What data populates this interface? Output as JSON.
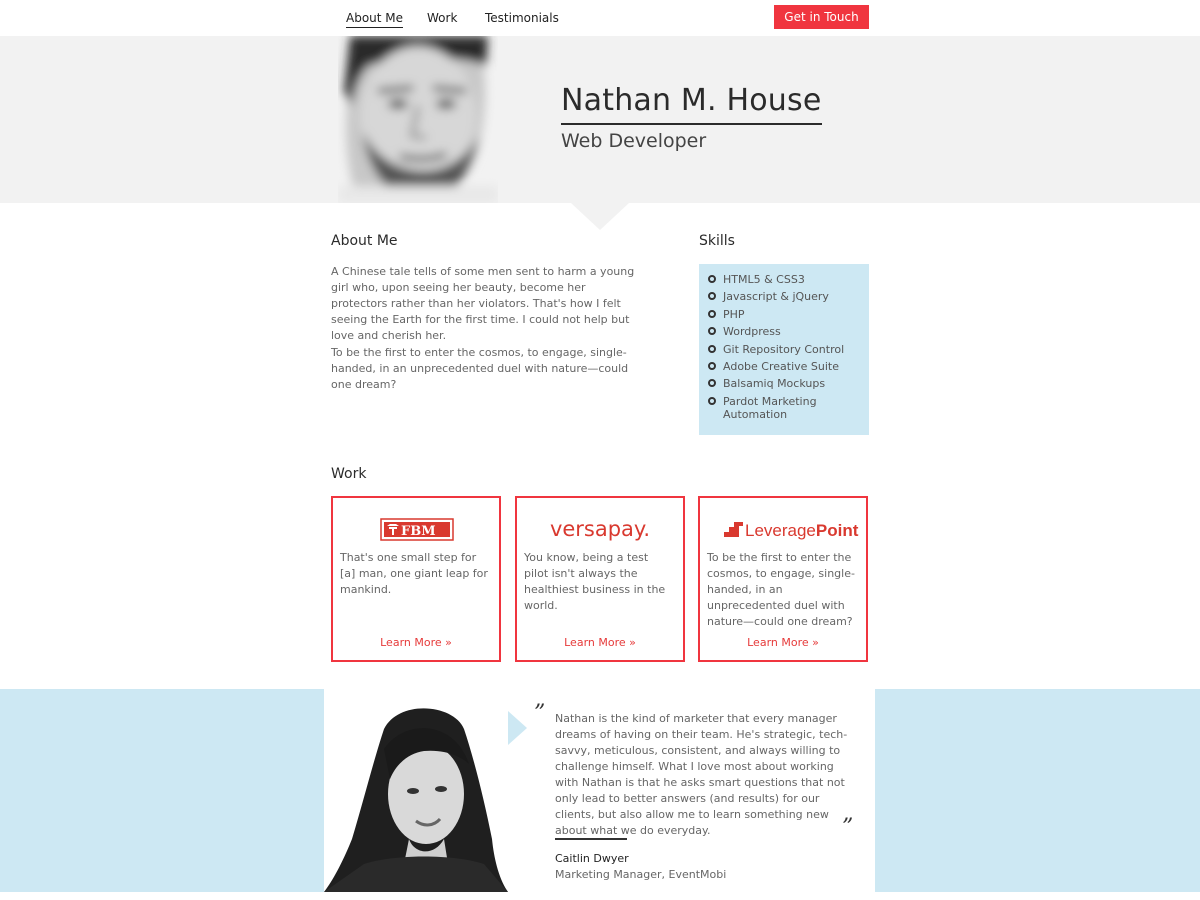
{
  "nav": {
    "items": [
      "About Me",
      "Work",
      "Testimonials"
    ],
    "active": "About Me",
    "cta_label": "Get in Touch"
  },
  "hero": {
    "name": "Nathan M. House",
    "role": "Web Developer"
  },
  "about": {
    "heading": "About Me",
    "para1": "A Chinese tale tells of some men sent to harm a young girl who, upon seeing her beauty, become her protectors rather than her violators. That's how I felt seeing the Earth for the first time. I could not help but love and cherish her.",
    "para2": "To be the first to enter the cosmos, to engage, single-handed, in an unprecedented duel with nature—could one dream?"
  },
  "skills": {
    "heading": "Skills",
    "items": [
      "HTML5 & CSS3",
      "Javascript & jQuery",
      "PHP",
      "Wordpress",
      "Git Repository Control",
      "Adobe Creative Suite",
      "Balsamiq Mockups",
      "Pardot Marketing Automation"
    ]
  },
  "work": {
    "heading": "Work",
    "cards": [
      {
        "logo_text": "FBM",
        "logo_icon": "tree-icon",
        "description": "That's one small step for [a] man, one giant leap for mankind.",
        "link": "Learn More »"
      },
      {
        "logo_text": "versapay.",
        "logo_icon": "",
        "description": "You know, being a test pilot isn't always the healthiest business in the world.",
        "link": "Learn More »"
      },
      {
        "logo_text_a": "Leverage",
        "logo_text_b": "Point",
        "logo_icon": "steps-icon",
        "description": "To be the first to enter the cosmos, to engage, single-handed, in an unprecedented duel with nature—could one dream?",
        "link": "Learn More »"
      }
    ]
  },
  "testimonial": {
    "open_quote": "”",
    "close_quote": "”",
    "quote": "Nathan is the kind of marketer that every manager dreams of having on their team. He's strategic, tech-savvy, meticulous, consistent, and always willing to challenge himself. What I love most about working with Nathan is that he asks smart questions that not only lead to better answers (and results) for our clients, but also allow me to learn something new about what we do everyday.",
    "author": "Caitlin Dwyer",
    "author_role": "Marketing Manager, EventMobi"
  },
  "colors": {
    "accent": "#f0353f",
    "hero_bg": "#f2f2f2",
    "skills_bg": "#cde8f3"
  }
}
